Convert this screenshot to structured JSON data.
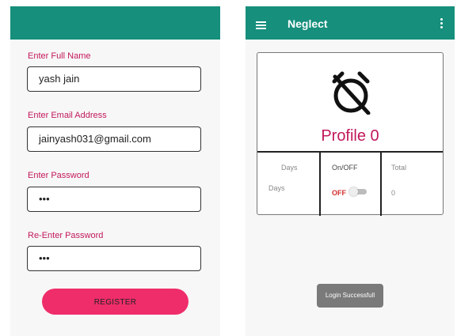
{
  "left_screen": {
    "fields": [
      {
        "label": "Enter Full Name",
        "value": "yash jain"
      },
      {
        "label": "Enter Email Address",
        "value": "jainyash031@gmail.com"
      },
      {
        "label": "Enter Password",
        "value": "•••"
      },
      {
        "label": "Re-Enter Password",
        "value": "•••"
      }
    ],
    "register_label": "REGISTER",
    "colors": {
      "appbar": "#168f7c",
      "accent": "#c2185b",
      "button": "#ef2d6a"
    }
  },
  "right_screen": {
    "title": "Neglect",
    "menu_icon": "menu-icon",
    "overflow_icon": "more-vert-icon",
    "card": {
      "icon": "alarm-off-icon",
      "profile_label": "Profile 0",
      "columns": [
        {
          "header": "Days",
          "value": "Days"
        },
        {
          "header": "On/OFF",
          "value": "OFF"
        },
        {
          "header": "Total",
          "value": "0"
        }
      ],
      "toggle_on": false
    },
    "toast": "Login Successfull"
  }
}
